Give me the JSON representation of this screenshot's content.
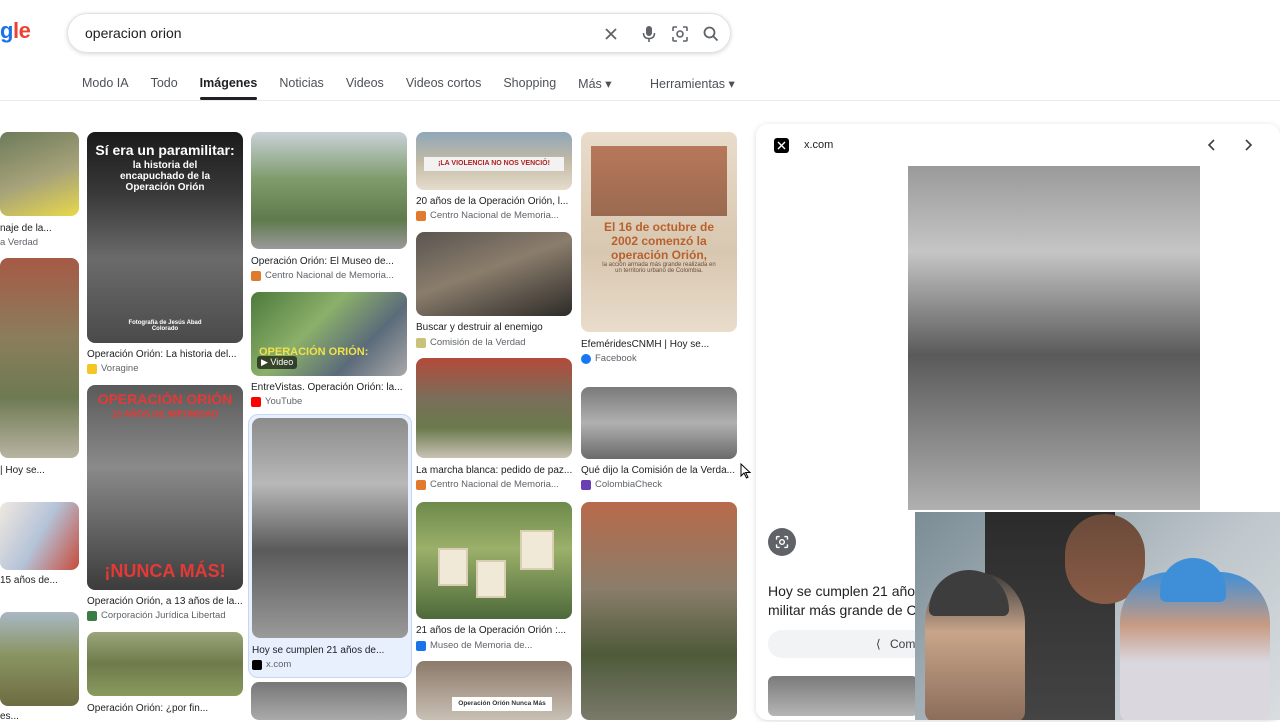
{
  "logo": {
    "part1": "g",
    "part2": "l",
    "part3": "e"
  },
  "search": {
    "value": "operacion orion"
  },
  "tabs": [
    {
      "label": "Modo IA"
    },
    {
      "label": "Todo"
    },
    {
      "label": "Imágenes",
      "active": true
    },
    {
      "label": "Noticias"
    },
    {
      "label": "Videos"
    },
    {
      "label": "Videos cortos"
    },
    {
      "label": "Shopping"
    },
    {
      "label": "Más ▾"
    }
  ],
  "tools_label": "Herramientas ▾",
  "col0": [
    {
      "caption": "naje de la...",
      "source": "a Verdad"
    },
    {
      "caption": "| Hoy se...",
      "source": ""
    },
    {
      "caption": "15 años de...",
      "source": ""
    },
    {
      "caption": "es...",
      "source": ""
    }
  ],
  "col1": [
    {
      "caption": "Operación Orión: La historia del...",
      "source": "Voragine",
      "overlay1": "Sí era un paramilitar:",
      "overlay2": "la historia del encapuchado de la Operación Orión",
      "overlay3": "Fotografía de Jesús Abad Colorado"
    },
    {
      "caption": "Operación Orión, a 13 años de la...",
      "source": "Corporación Jurídica Libertad",
      "overlay1": "OPERACIÓN ORIÓN",
      "overlay2": "13 AÑOS DE IMPUNIDAD",
      "overlay3": "¡NUNCA MÁS!"
    },
    {
      "caption": "Operación Orión: ¿por fin...",
      "source": ""
    }
  ],
  "col2": [
    {
      "caption": "Operación Orión: El Museo de...",
      "source": "Centro Nacional de Memoria..."
    },
    {
      "caption": "EntreVistas. Operación Orión: la...",
      "source": "YouTube",
      "overlay1": "OPERACIÓN ORIÓN:",
      "badge": "▶ Video"
    },
    {
      "caption": "Hoy se cumplen 21 años de...",
      "source": "x.com"
    }
  ],
  "col3": [
    {
      "caption": "20 años de la Operación Orión, l...",
      "source": "Centro Nacional de Memoria...",
      "banner": "¡LA VIOLENCIA NO NOS VENCIÓ!"
    },
    {
      "caption": "Buscar y destruir al enemigo",
      "source": "Comisión de la Verdad"
    },
    {
      "caption": "La marcha blanca: pedido de paz...",
      "source": "Centro Nacional de Memoria..."
    },
    {
      "caption": "21 años de la Operación Orión :...",
      "source": "Museo de Memoria de..."
    },
    {
      "caption": "",
      "source": "",
      "banner": "Operación Orión Nunca Más"
    }
  ],
  "col4": [
    {
      "caption": "EfeméridesCNMH | Hoy se...",
      "source": "Facebook",
      "overlay1": "El 16 de octubre de 2002 comenzó la operación Orión,",
      "overlay2": "la acción armada más grande realizada en un territorio urbano de Colombia."
    },
    {
      "caption": "Qué dijo la Comisión de la Verda...",
      "source": "ColombiaCheck"
    },
    {
      "caption": "",
      "source": ""
    }
  ],
  "preview": {
    "site": "x.com",
    "text_line1": "Hoy se cumplen 21 años",
    "text_line2": "militar más grande de C",
    "share_label": "Comp"
  },
  "colors": {
    "accent": "#1a73e8",
    "tab_underline": "#202124",
    "border": "#dfe1e5"
  }
}
